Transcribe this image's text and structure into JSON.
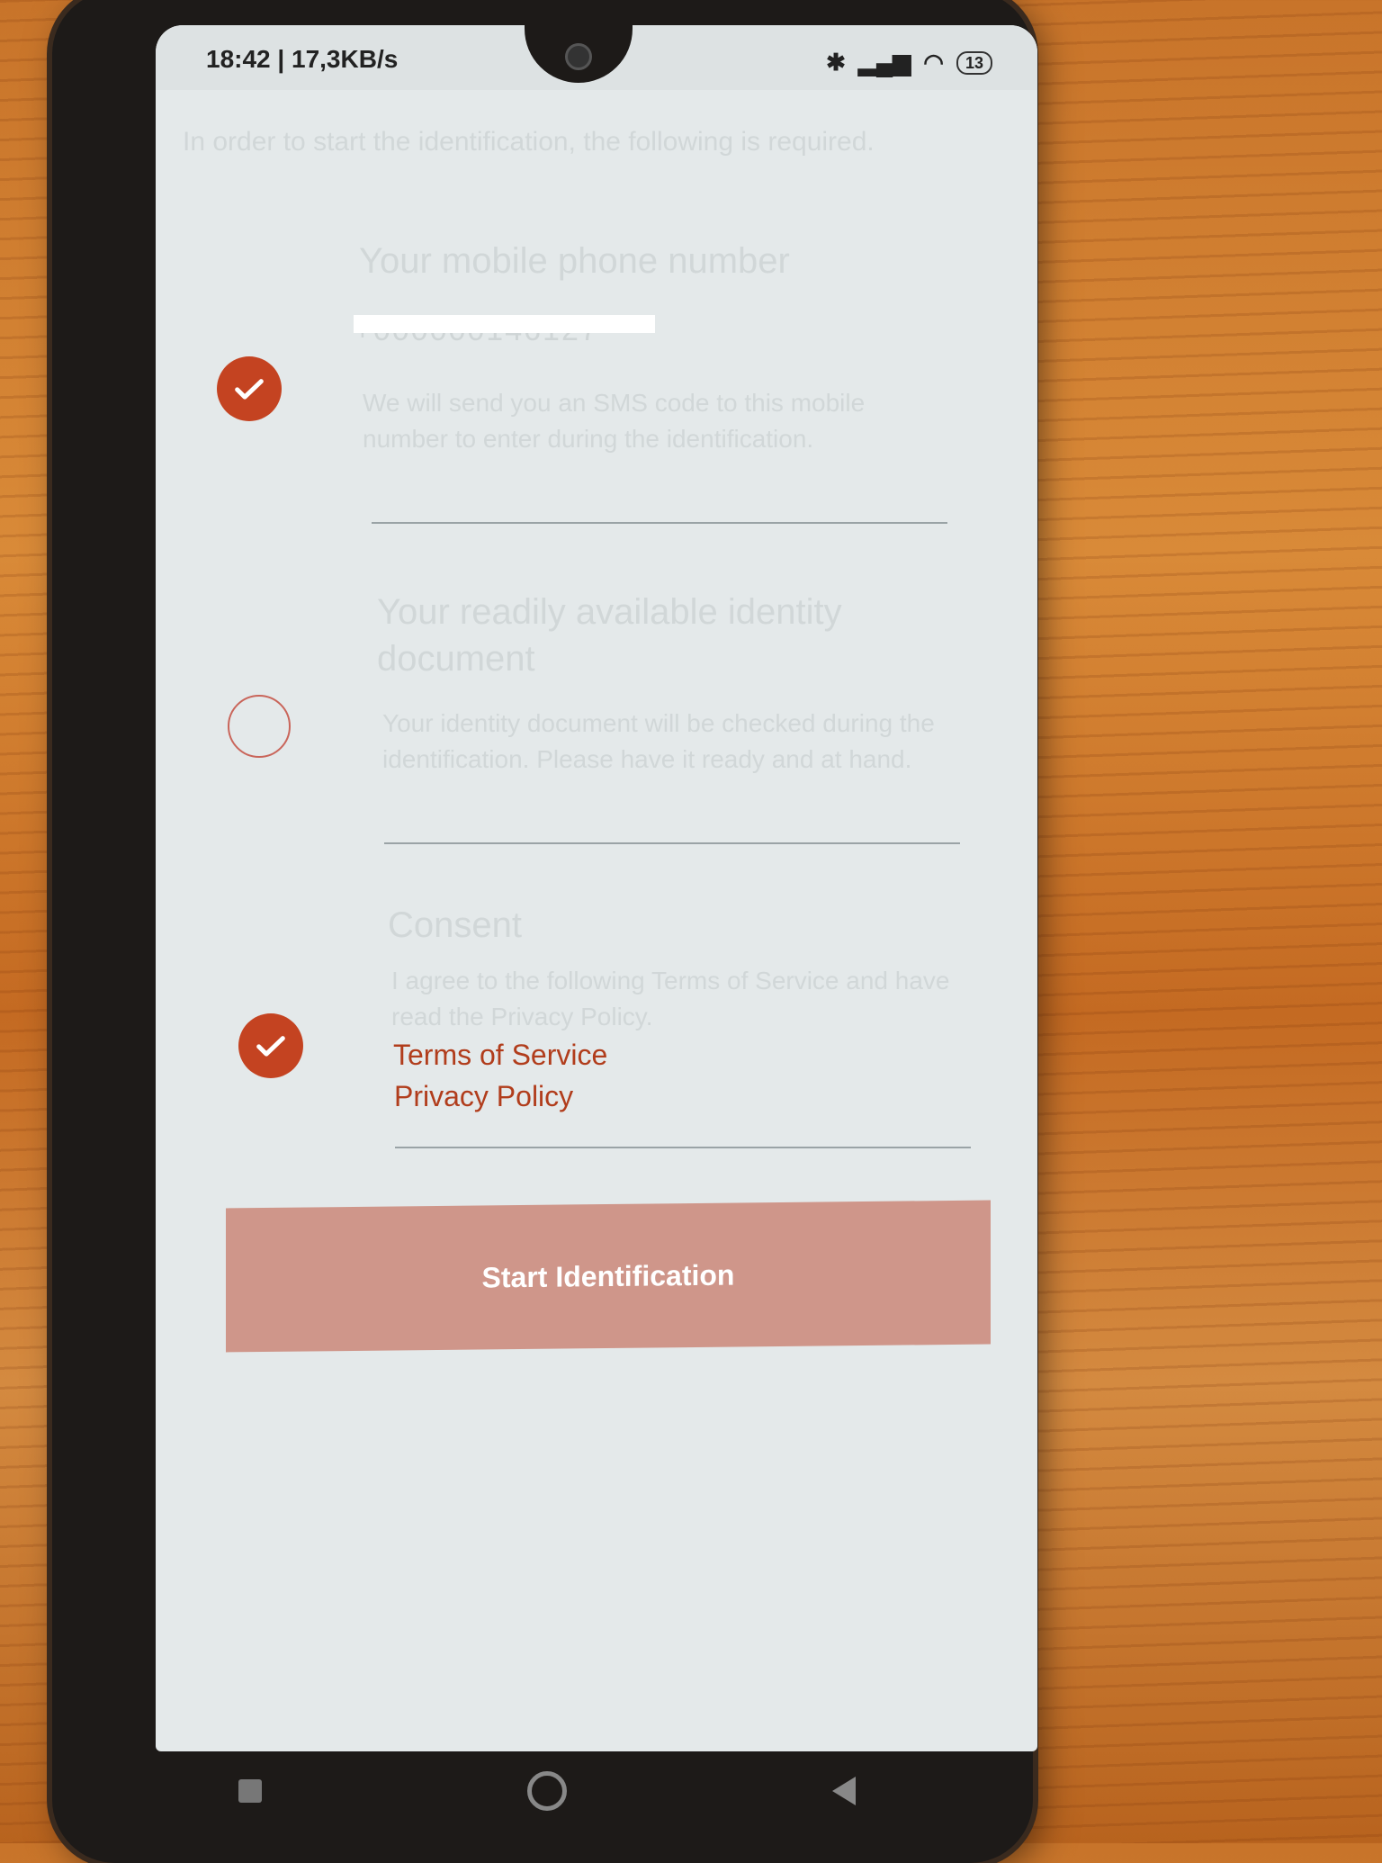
{
  "status_bar": {
    "time_speed": "18:42 | 17,3KB/s",
    "battery": "13",
    "icons": [
      "bluetooth-icon",
      "signal-icon",
      "wifi-icon",
      "battery-icon"
    ]
  },
  "intro_text": "In order to start the identification, the following is required.",
  "sections": {
    "phone": {
      "title": "Your mobile phone number",
      "value": "+000000146127",
      "body": "We will send you an SMS code to this mobile number to enter during the identification.",
      "checked": true
    },
    "document": {
      "title": "Your readily available identity document",
      "body": "Your identity document will be checked during the identification. Please have it ready and at hand.",
      "checked": false
    },
    "consent": {
      "title": "Consent",
      "body": "I agree to the following Terms of Service and have read the Privacy Policy.",
      "checked": true,
      "links": [
        "Terms of Service",
        "Privacy Policy"
      ]
    }
  },
  "start_button_label": "Start Identification",
  "colors": {
    "accent": "#c44321",
    "button": "#cf968a",
    "link": "#b13d1c",
    "screen_bg": "#e4e9ea"
  }
}
